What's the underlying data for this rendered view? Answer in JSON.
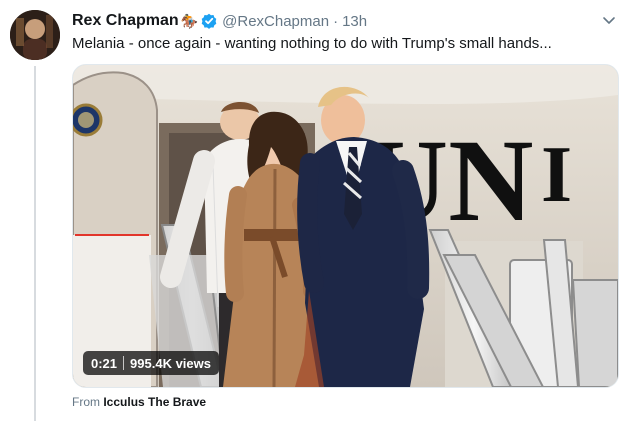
{
  "tweet": {
    "author": {
      "display_name": "Rex Chapman",
      "emoji": "🏇",
      "verified": true,
      "handle": "@RexChapman",
      "separator": "·",
      "timestamp": "13h"
    },
    "text": "Melania - once again - wanting nothing to do with Trump's small hands...",
    "media": {
      "duration": "0:21",
      "views": "995.4K views"
    },
    "source": {
      "prefix": "From",
      "name": "Icculus The Brave"
    },
    "icons": {
      "verified": "verified-badge-icon",
      "more": "chevron-down-icon"
    },
    "colors": {
      "text_primary": "#14171a",
      "text_secondary": "#657786",
      "verified_blue": "#1da1f2",
      "media_overlay": "#000000"
    }
  }
}
